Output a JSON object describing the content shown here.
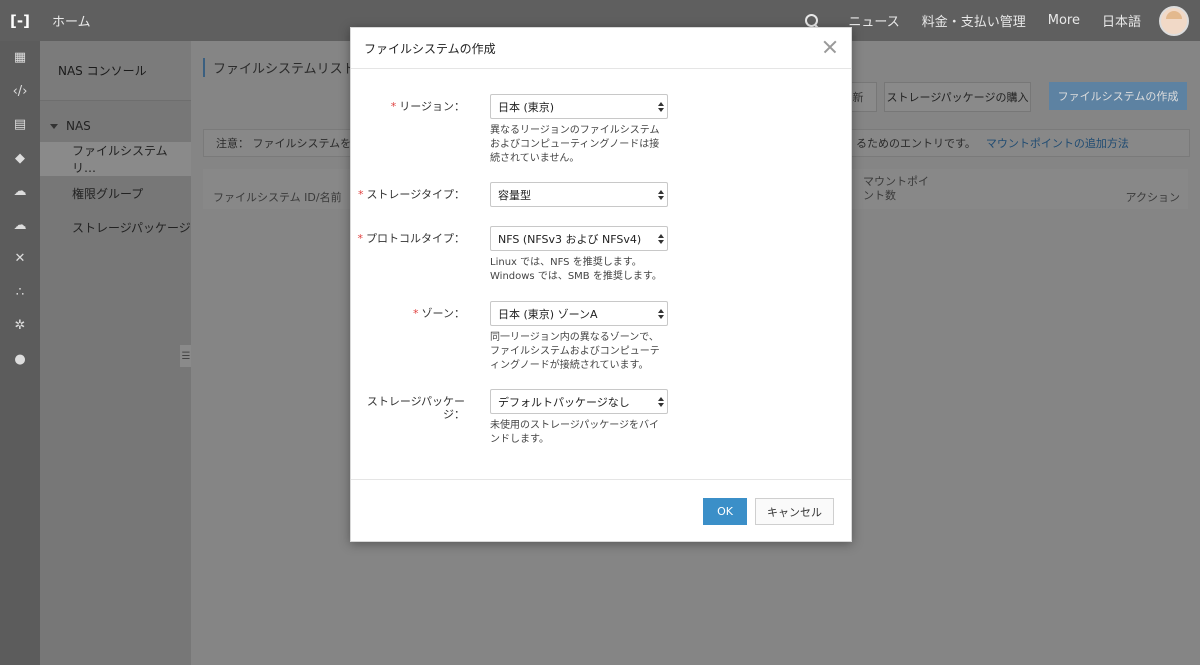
{
  "topbar": {
    "logo": "[-]",
    "home": "ホーム",
    "nav": [
      "ニュース",
      "料金・支払い管理",
      "More",
      "日本語"
    ]
  },
  "sidebar": {
    "title": "NAS コンソール",
    "group": "NAS",
    "items": [
      {
        "label": "ファイルシステムリ…",
        "active": true
      },
      {
        "label": "権限グループ"
      },
      {
        "label": "ストレージパッケージ"
      }
    ]
  },
  "main": {
    "page_title": "ファイルシステムリスト",
    "refresh_partial": "新",
    "buy_package": "ストレージパッケージの購入",
    "create_fs": "ファイルシステムの作成",
    "notice_left": "注意： ファイルシステムを作",
    "notice_right": "るためのエントリです。",
    "notice_link": "マウントポイントの追加方法",
    "col_id": "ファイルシステム ID/名前",
    "col_mount_1": "マウントポイ",
    "col_mount_2": "ント数",
    "col_action": "アクション"
  },
  "modal": {
    "title": "ファイルシステムの作成",
    "fields": [
      {
        "label": "リージョン：",
        "required": true,
        "value": "日本 (東京)",
        "help": [
          "異なるリージョンのファイルシステム",
          "およびコンピューティングノードは接",
          "続されていません。"
        ]
      },
      {
        "label": "ストレージタイプ：",
        "required": true,
        "value": "容量型",
        "help": []
      },
      {
        "label": "プロトコルタイプ：",
        "required": true,
        "value": "NFS (NFSv3 および NFSv4)",
        "help": [
          "Linux では、NFS を推奨します。",
          "Windows では、SMB を推奨します。"
        ]
      },
      {
        "label": "ゾーン：",
        "required": true,
        "value": "日本 (東京) ゾーンA",
        "help": [
          "同一リージョン内の異なるゾーンで、",
          "ファイルシステムおよびコンピューテ",
          "ィングノードが接続されています。"
        ]
      },
      {
        "label_1": "ストレージパッケー",
        "label_2": "ジ：",
        "required": false,
        "value": "デフォルトパッケージなし",
        "help": [
          "未使用のストレージパッケージをバイ",
          "ンドします。"
        ]
      }
    ],
    "ok": "OK",
    "cancel": "キャンセル"
  }
}
